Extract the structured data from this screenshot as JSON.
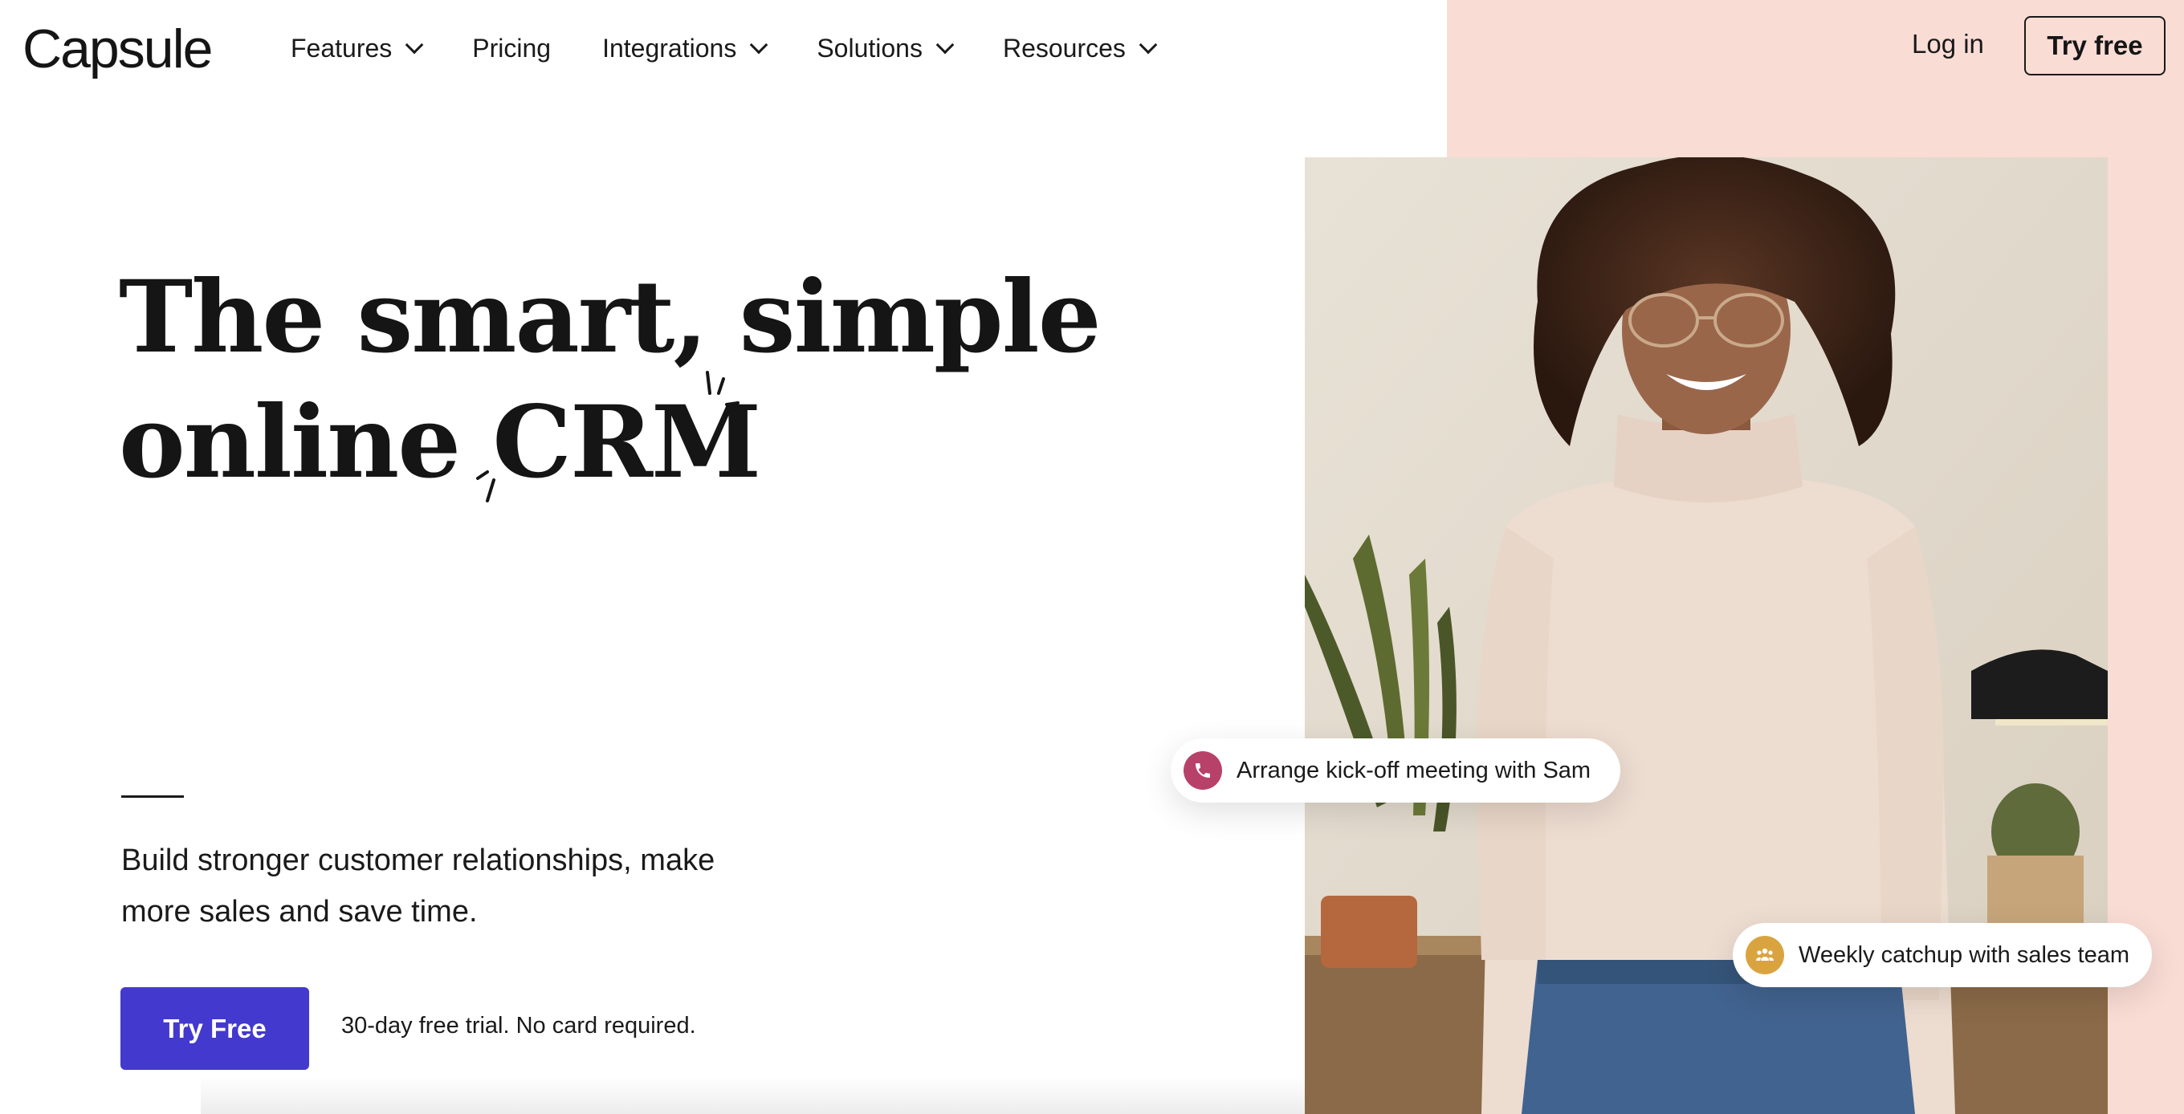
{
  "header": {
    "logo": "Capsule",
    "nav": [
      {
        "label": "Features",
        "has_dropdown": true
      },
      {
        "label": "Pricing",
        "has_dropdown": false
      },
      {
        "label": "Integrations",
        "has_dropdown": true
      },
      {
        "label": "Solutions",
        "has_dropdown": true
      },
      {
        "label": "Resources",
        "has_dropdown": true
      }
    ],
    "login_label": "Log in",
    "try_free_label": "Try free"
  },
  "hero": {
    "headline_line1": "The smart, simple",
    "headline_line2_prefix": "online ",
    "headline_highlight": "CRM",
    "subtext": "Build stronger customer relationships, make more sales and save time.",
    "cta_label": "Try Free",
    "trial_note": "30-day free trial. No card required."
  },
  "photo": {
    "alt": "Smiling woman in a beige turtleneck and glasses"
  },
  "notifications": [
    {
      "icon": "phone-icon",
      "label": "Arrange kick-off meeting with Sam",
      "color": "#b8416a"
    },
    {
      "icon": "team-icon",
      "label": "Weekly catchup with sales team",
      "color": "#d9a440"
    }
  ],
  "colors": {
    "accent": "#4339cf",
    "panel": "#f9dcd4",
    "text": "#151515"
  }
}
